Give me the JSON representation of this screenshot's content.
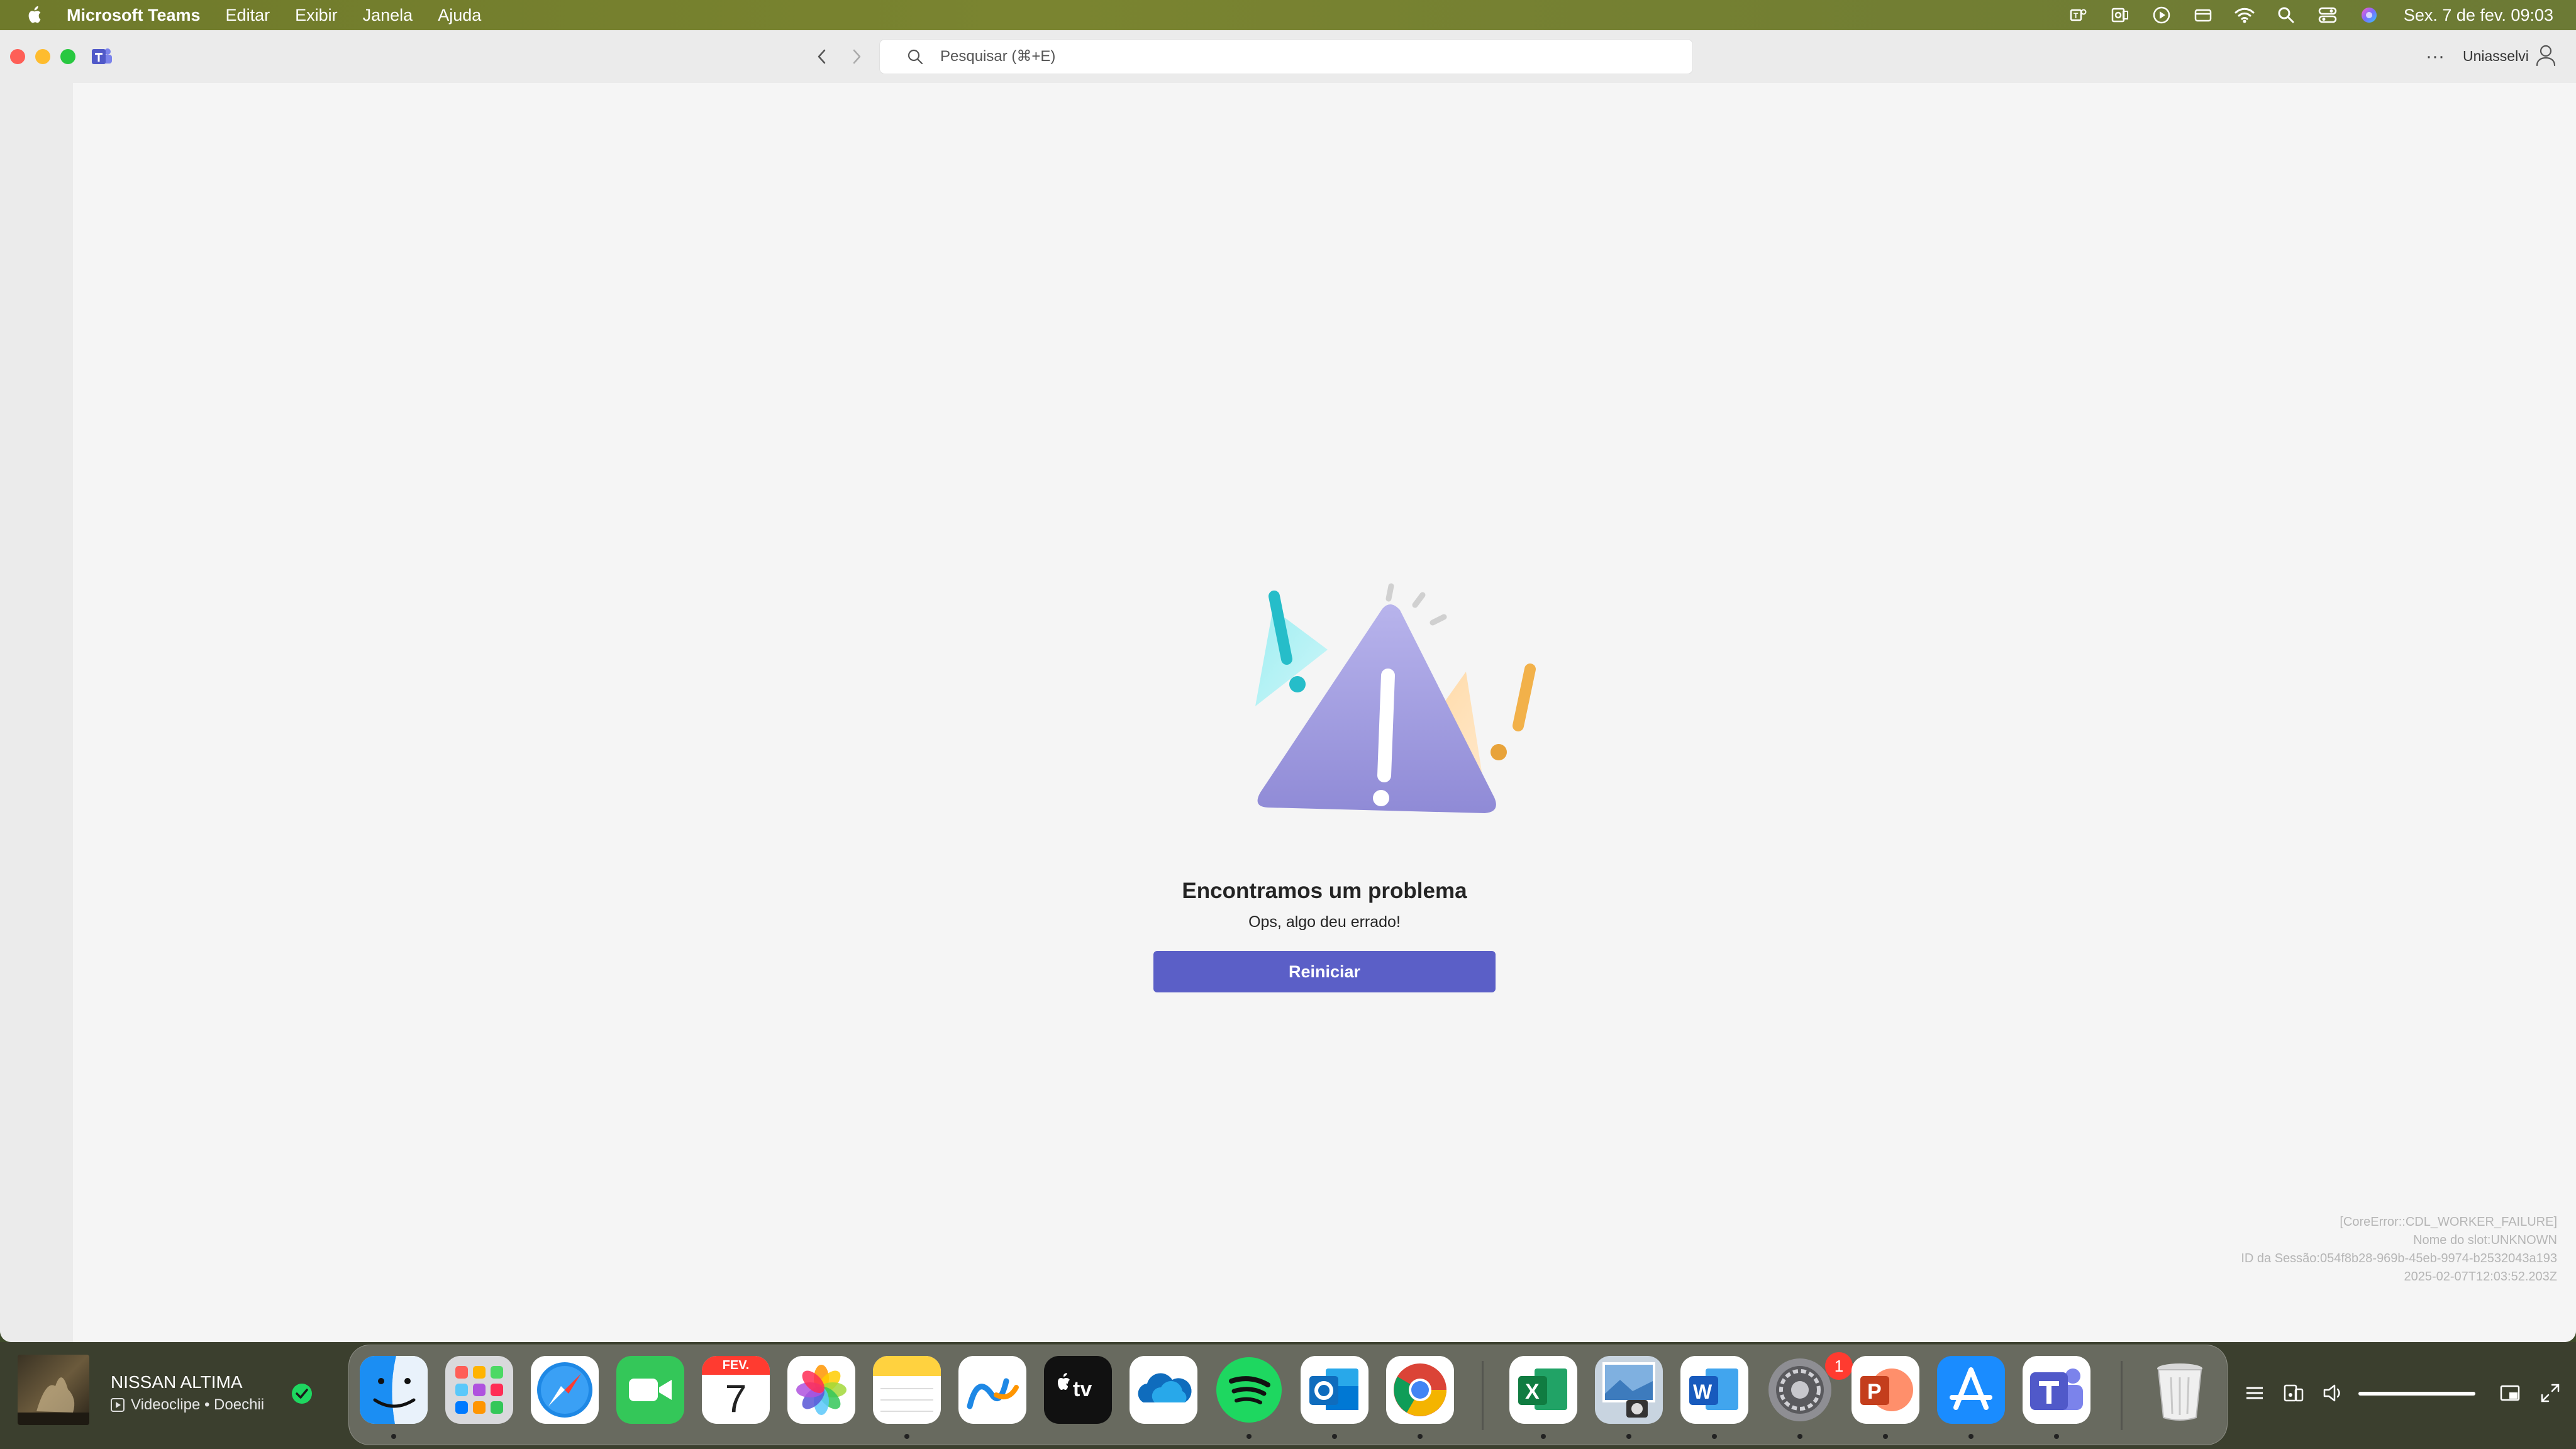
{
  "menubar": {
    "app_name": "Microsoft Teams",
    "items": [
      "Editar",
      "Exibir",
      "Janela",
      "Ajuda"
    ],
    "clock": "Sex. 7 de fev.  09:03"
  },
  "toolbar": {
    "search_placeholder": "Pesquisar (⌘+E)",
    "more_label": "···",
    "account_name": "Uniasselvi"
  },
  "error": {
    "title": "Encontramos um problema",
    "subtitle": "Ops, algo deu errado!",
    "restart_label": "Reiniciar",
    "diagnostics": [
      "[CoreError::CDL_WORKER_FAILURE]",
      "Nome do slot:UNKNOWN",
      "ID da Sessão:054f8b28-969b-45eb-9974-b2532043a193",
      "2025-02-07T12:03:52.203Z"
    ]
  },
  "now_playing": {
    "title": "NISSAN ALTIMA",
    "subtitle": "Videoclipe • Doechii"
  },
  "dock": {
    "apps": [
      "finder-icon",
      "launchpad-icon",
      "safari-icon",
      "facetime-icon",
      "calendar-icon",
      "photos-icon",
      "notes-icon",
      "freeform-icon",
      "apple-tv-icon",
      "onedrive-icon",
      "spotify-icon",
      "outlook-icon",
      "chrome-icon",
      "excel-icon",
      "preview-icon",
      "word-icon",
      "system-settings-icon",
      "powerpoint-icon",
      "app-store-icon",
      "teams-icon",
      "trash-icon"
    ],
    "calendar_month": "FEV.",
    "calendar_day": "7",
    "settings_badge": "1"
  },
  "colors": {
    "accent": "#5b5fc7",
    "menubar": "#76802f"
  }
}
